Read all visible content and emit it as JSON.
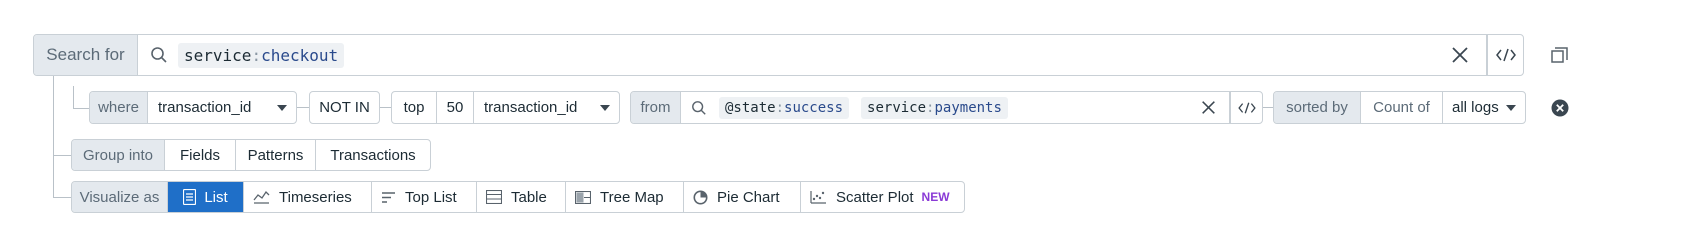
{
  "search": {
    "label": "Search for",
    "query_key": "service",
    "query_colon": ":",
    "query_value": "checkout"
  },
  "where_row": {
    "where_label": "where",
    "where_field": "transaction_id",
    "operator": "NOT IN",
    "top_label": "top",
    "top_count": "50",
    "top_field": "transaction_id",
    "from_label": "from",
    "from_chips": [
      {
        "key": "@state",
        "colon": ":",
        "value": "success"
      },
      {
        "key": "service",
        "colon": ":",
        "value": "payments"
      }
    ],
    "sorted_label": "sorted by",
    "count_of_label": "Count of",
    "count_of_value": "all logs"
  },
  "group_row": {
    "label": "Group into",
    "options": [
      "Fields",
      "Patterns",
      "Transactions"
    ]
  },
  "visualize_row": {
    "label": "Visualize as",
    "options": [
      {
        "label": "List",
        "icon": "list-icon",
        "active": true
      },
      {
        "label": "Timeseries",
        "icon": "timeseries-icon"
      },
      {
        "label": "Top List",
        "icon": "top-list-icon"
      },
      {
        "label": "Table",
        "icon": "table-icon"
      },
      {
        "label": "Tree Map",
        "icon": "tree-map-icon"
      },
      {
        "label": "Pie Chart",
        "icon": "pie-chart-icon"
      },
      {
        "label": "Scatter Plot",
        "icon": "scatter-plot-icon",
        "badge": "NEW"
      }
    ]
  },
  "colors": {
    "accent": "#1f6fc8",
    "new_badge": "#8a3ad6",
    "label_bg": "#e4e9ee",
    "border": "#c9d0d6"
  }
}
